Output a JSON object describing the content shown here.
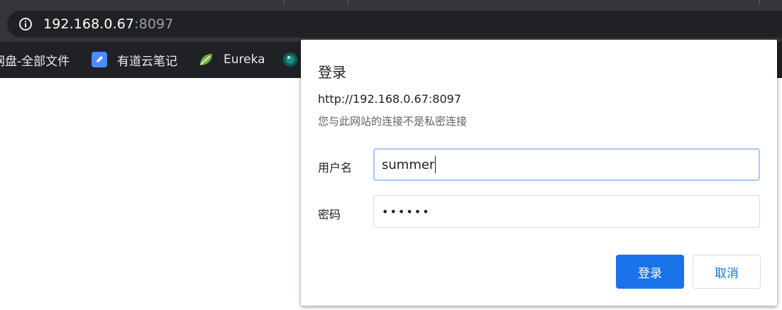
{
  "address_bar": {
    "host": "192.168.0.67",
    "port": ":8097"
  },
  "bookmarks": [
    {
      "label": "网盘-全部文件",
      "icon": "cloud-drive-icon"
    },
    {
      "label": "有道云笔记",
      "icon": "youdao-note-icon"
    },
    {
      "label": "Eureka",
      "icon": "spring-leaf-icon"
    },
    {
      "label": "",
      "icon": "globe-icon"
    }
  ],
  "login_dialog": {
    "title": "登录",
    "origin": "http://192.168.0.67:8097",
    "warning": "您与此网站的连接不是私密连接",
    "username_label": "用户名",
    "username_value": "summer",
    "password_label": "密码",
    "password_value": "••••••",
    "submit_label": "登录",
    "cancel_label": "取消"
  },
  "colors": {
    "accent": "#1a73e8",
    "chrome_dark": "#35363a",
    "bookmark_bar": "#202124"
  }
}
